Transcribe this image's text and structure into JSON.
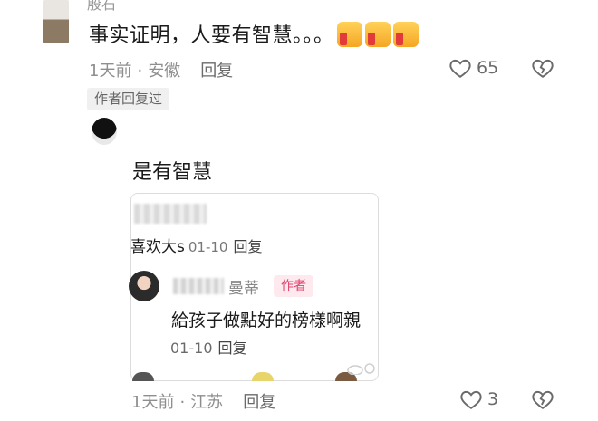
{
  "comment": {
    "author_partial": "殷石",
    "text": "事实证明，人要有智慧。。。",
    "emoji": [
      "thumbs-up",
      "thumbs-up",
      "thumbs-up"
    ],
    "time": "1天前",
    "location": "安徽",
    "reply_label": "回复",
    "likes": "65",
    "author_replied_tag": "作者回复过"
  },
  "reply": {
    "text": "是有智慧",
    "quote": {
      "text": "喜欢大s",
      "time": "01-10",
      "reply_label": "回复",
      "nested": {
        "name_suffix": "曼蒂",
        "badge": "作者",
        "text": "給孩子做點好的榜樣啊親",
        "time": "01-10",
        "reply_label": "回复"
      }
    },
    "time": "1天前",
    "location": "江苏",
    "reply_label": "回复",
    "likes": "3"
  },
  "colors": {
    "author_badge_text": "#e0436d",
    "author_badge_bg": "#fde9ee",
    "meta_gray": "#8e8e8e"
  }
}
